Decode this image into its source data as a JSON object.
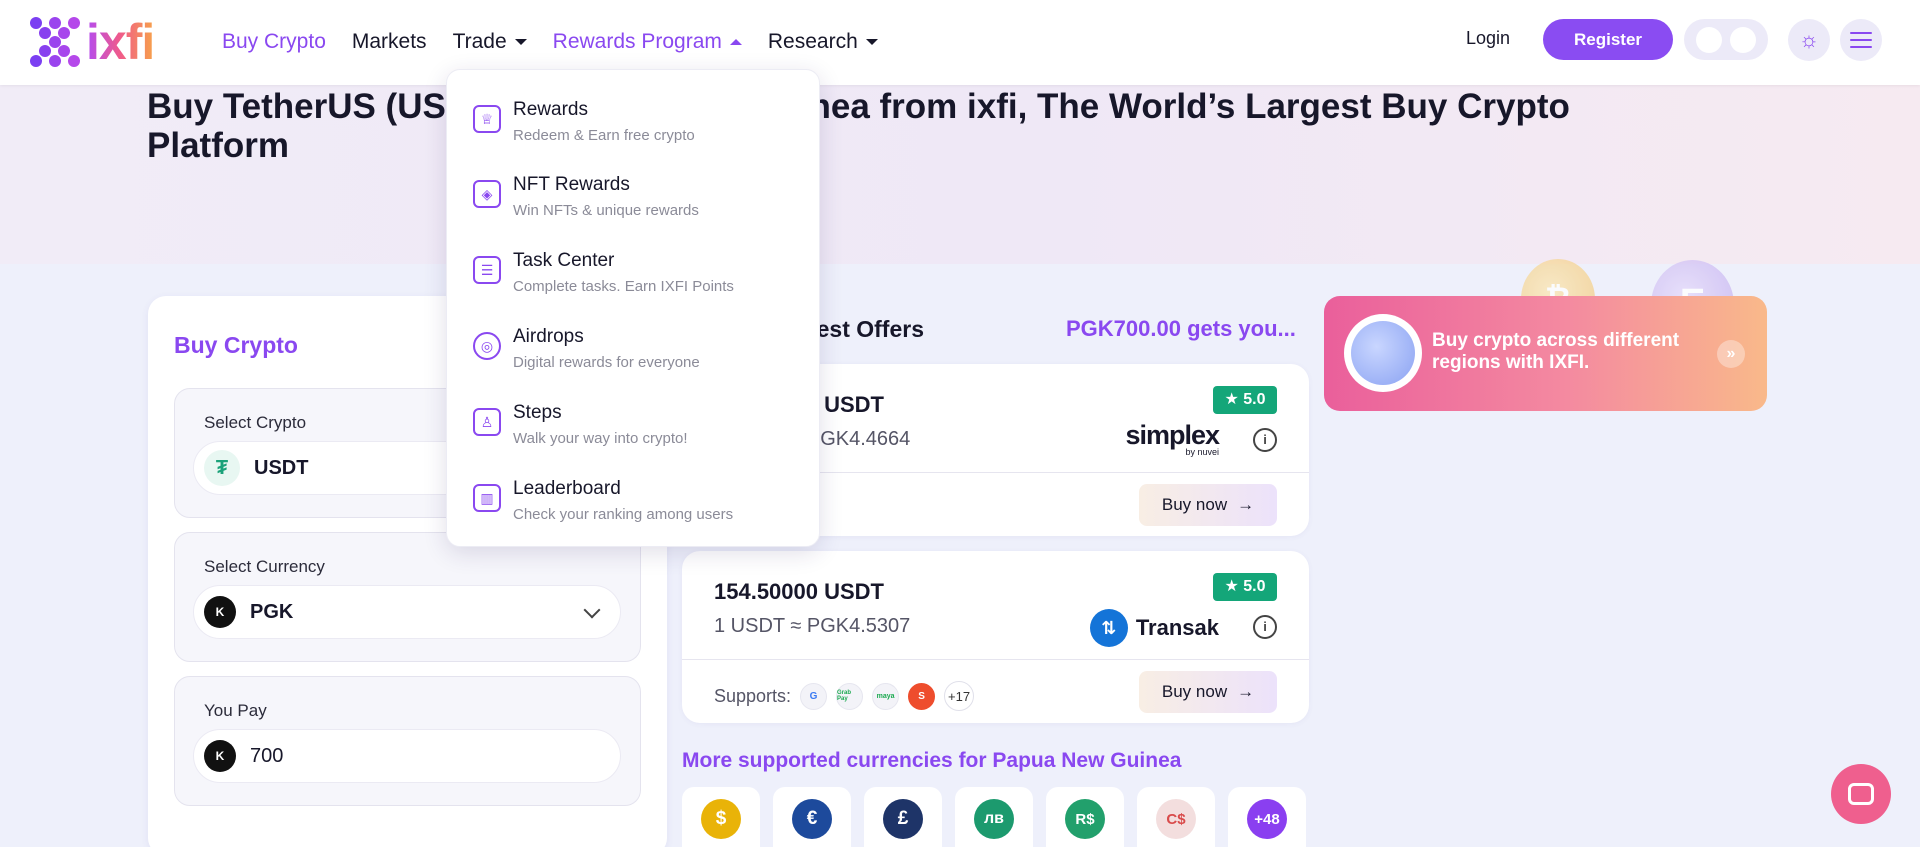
{
  "header": {
    "logo_text": "ixfi",
    "nav": [
      {
        "label": "Buy Crypto",
        "active": true,
        "dropdown": false
      },
      {
        "label": "Markets",
        "active": false,
        "dropdown": false
      },
      {
        "label": "Trade",
        "active": false,
        "dropdown": true
      },
      {
        "label": "Rewards Program",
        "active": true,
        "dropdown": true,
        "open": true
      },
      {
        "label": "Research",
        "active": false,
        "dropdown": true
      }
    ],
    "login_label": "Login",
    "register_label": "Register",
    "theme_icon": "sun-icon",
    "menu_icon": "hamburger-icon"
  },
  "hero": {
    "title": "Buy TetherUS (USDT) in Papua New Guinea from ixfi, The World’s Largest Buy Crypto Platform"
  },
  "dropdown": {
    "items": [
      {
        "icon": "trophy-icon",
        "title": "Rewards",
        "subtitle": "Redeem & Earn free crypto"
      },
      {
        "icon": "nft-trophy-icon",
        "title": "NFT Rewards",
        "subtitle": "Win NFTs & unique rewards"
      },
      {
        "icon": "checklist-icon",
        "title": "Task Center",
        "subtitle": "Complete tasks. Earn IXFI Points"
      },
      {
        "icon": "airdrop-icon",
        "title": "Airdrops",
        "subtitle": "Digital rewards for everyone"
      },
      {
        "icon": "walker-icon",
        "title": "Steps",
        "subtitle": "Walk your way into crypto!"
      },
      {
        "icon": "leaderboard-icon",
        "title": "Leaderboard",
        "subtitle": "Check your ranking among users"
      }
    ]
  },
  "buy": {
    "title": "Buy Crypto",
    "crypto_label": "Select Crypto",
    "crypto_value": "USDT",
    "currency_label": "Select Currency",
    "currency_value": "PGK",
    "pay_label": "You Pay",
    "pay_value": "700",
    "currency_symbol": "K"
  },
  "offers": {
    "title": "Best Offers",
    "amount_text": "PGK700.00 gets you...",
    "list": [
      {
        "qty": "156.70496 USDT",
        "rate": "1 USDT ≈ PGK4.4664",
        "rating": "5.0",
        "provider": "simplex",
        "provider_sub": "by nuvei",
        "buy_label": "Buy now"
      },
      {
        "qty": "154.50000 USDT",
        "rate": "1 USDT ≈ PGK4.5307",
        "rating": "5.0",
        "provider": "Transak",
        "supports_label": "Supports:",
        "payment_methods": [
          "G",
          "Grab Pay",
          "maya",
          "S"
        ],
        "more_count": "+17",
        "buy_label": "Buy now"
      }
    ]
  },
  "more_currencies": {
    "title": "More supported currencies for Papua New Guinea",
    "items": [
      {
        "symbol": "$",
        "color": "#e9b308"
      },
      {
        "symbol": "€",
        "color": "#1d4a9c"
      },
      {
        "symbol": "£",
        "color": "#1e3468"
      },
      {
        "symbol": "лв",
        "color": "#1c9a6e"
      },
      {
        "symbol": "R$",
        "color": "#22a06c"
      },
      {
        "symbol": "C$",
        "color": "#d94b4b"
      },
      {
        "symbol": "+48",
        "color": "#8a3ff0"
      }
    ]
  },
  "promo": {
    "text": "Buy crypto across different regions with IXFI."
  },
  "colors": {
    "accent": "#8a48f0",
    "rating_green": "#14a679",
    "promo_start": "#ea5f9b",
    "promo_end": "#f9b98a"
  }
}
